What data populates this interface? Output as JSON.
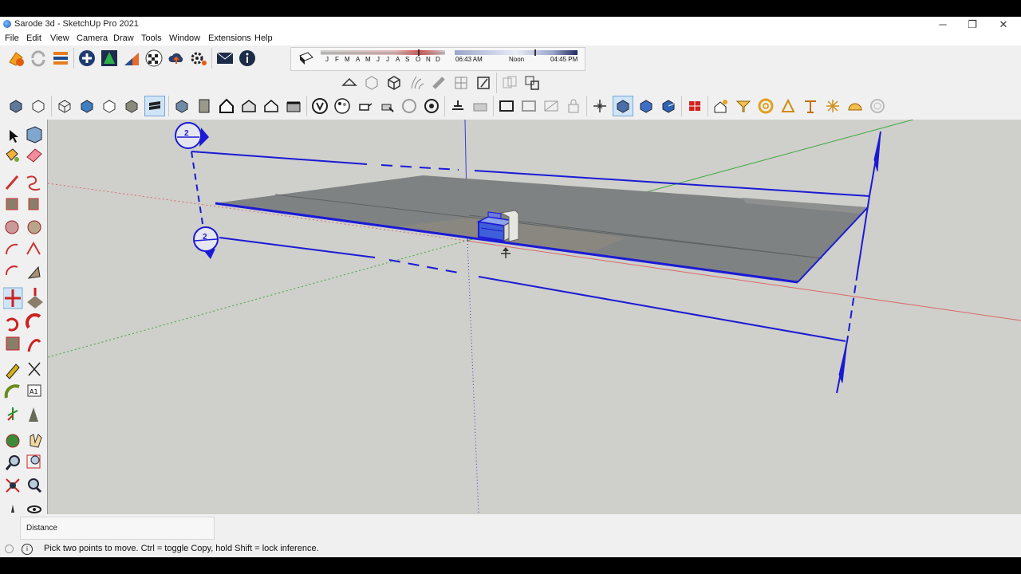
{
  "window": {
    "title": "Sarode 3d - SketchUp Pro 2021",
    "controls": {
      "minimize": "─",
      "maximize": "❐",
      "close": "✕"
    }
  },
  "menubar": {
    "items": [
      "File",
      "Edit",
      "View",
      "Camera",
      "Draw",
      "Tools",
      "Window",
      "Extensions",
      "Help"
    ]
  },
  "shadows": {
    "months": [
      "J",
      "F",
      "M",
      "A",
      "M",
      "J",
      "J",
      "A",
      "S",
      "O",
      "N",
      "D"
    ],
    "sunrise": "06:43 AM",
    "noon": "Noon",
    "sunset": "04:45 PM",
    "month_position": 0.78,
    "time_position": 0.65
  },
  "viewport": {
    "dimension_left_top": "2",
    "dimension_left_bottom": "2"
  },
  "measurements": {
    "label": "Distance"
  },
  "status": {
    "text": "Pick two points to move.  Ctrl = toggle Copy, hold Shift = lock inference.",
    "info_icon": "i"
  },
  "colors": {
    "selection_blue": "#1a1ad6",
    "viewport_bg": "#cfcfcb",
    "ground_gray": "#7f8282",
    "axis_red": "#d96a6a",
    "axis_green": "#3aa83a"
  }
}
